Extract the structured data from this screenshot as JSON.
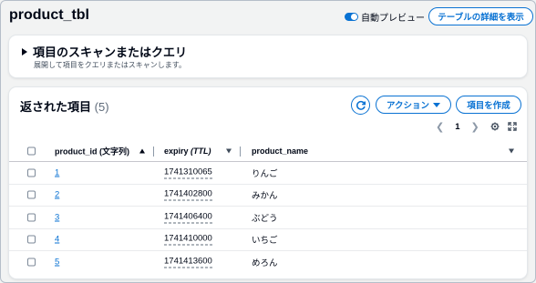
{
  "header": {
    "title": "product_tbl",
    "auto_preview_label": "自動プレビュー",
    "auto_preview_on": true,
    "details_button": "テーブルの詳細を表示"
  },
  "scan": {
    "heading": "項目のスキャンまたはクエリ",
    "description": "展開して項目をクエリまたはスキャンします。"
  },
  "items": {
    "heading": "返された項目",
    "count": "(5)",
    "action_button": "アクション",
    "create_button": "項目を作成",
    "page": "1",
    "columns": {
      "id_label": "product_id",
      "id_type": "(文字列)",
      "expiry_label": "expiry",
      "expiry_type": "(TTL)",
      "name_label": "product_name"
    },
    "rows": [
      {
        "id": "1",
        "expiry": "1741310065",
        "name": "りんご"
      },
      {
        "id": "2",
        "expiry": "1741402800",
        "name": "みかん"
      },
      {
        "id": "3",
        "expiry": "1741406400",
        "name": "ぶどう"
      },
      {
        "id": "4",
        "expiry": "1741410000",
        "name": "いちご"
      },
      {
        "id": "5",
        "expiry": "1741413600",
        "name": "めろん"
      }
    ]
  },
  "colors": {
    "accent": "#0972d3",
    "text": "#000716",
    "background": "#f2f3f3"
  }
}
